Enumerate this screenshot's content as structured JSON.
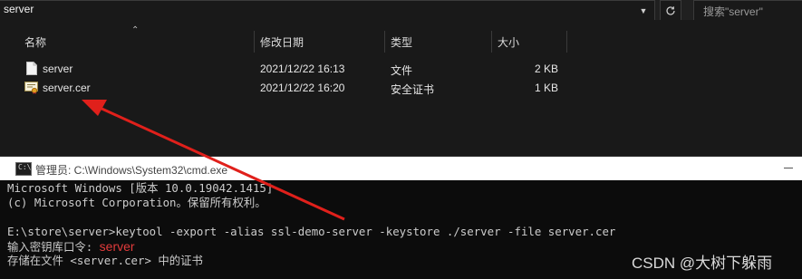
{
  "explorer": {
    "address": "server",
    "search_placeholder": "搜索\"server\"",
    "columns": [
      "名称",
      "修改日期",
      "类型",
      "大小"
    ],
    "files": [
      {
        "name": "server",
        "modified": "2021/12/22 16:13",
        "type": "文件",
        "size": "2 KB",
        "icon": "file-icon"
      },
      {
        "name": "server.cer",
        "modified": "2021/12/22 16:20",
        "type": "安全证书",
        "size": "1 KB",
        "icon": "certificate-icon"
      }
    ]
  },
  "cmd": {
    "title": "管理员: C:\\Windows\\System32\\cmd.exe",
    "lines": [
      "Microsoft Windows [版本 10.0.19042.1415]",
      "(c) Microsoft Corporation。保留所有权利。",
      "",
      "E:\\store\\server>keytool -export -alias ssl-demo-server -keystore ./server -file server.cer",
      "输入密钥库口令:"
    ],
    "password_text": "server",
    "last_line": "存储在文件 <server.cer> 中的证书"
  },
  "annotation": {
    "arrow_color": "#e0201b"
  },
  "watermark": "CSDN @大树下躲雨"
}
